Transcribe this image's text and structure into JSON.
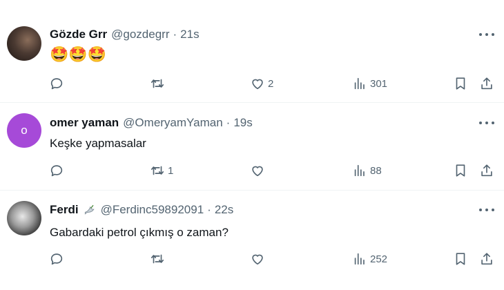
{
  "tweets": [
    {
      "name": "Gözde Grr",
      "handle": "@gozdegrr",
      "time": "21s",
      "text": "🤩🤩🤩",
      "replies": "",
      "retweets": "",
      "likes": "2",
      "views": "301"
    },
    {
      "name": "omer yaman",
      "handle": "@OmeryamYaman",
      "time": "19s",
      "avatar_letter": "o",
      "text": "Keşke yapmasalar",
      "replies": "",
      "retweets": "1",
      "likes": "",
      "views": "88"
    },
    {
      "name": "Ferdi",
      "handle": "@Ferdinc59892091",
      "time": "22s",
      "text": "Gabardaki petrol çıkmış o zaman?",
      "replies": "",
      "retweets": "",
      "likes": "",
      "views": "252"
    }
  ],
  "separator": "·",
  "colors": {
    "muted": "#536471",
    "text": "#0f1419",
    "avatar_purple": "#a64ad8"
  },
  "icons": [
    "reply-icon",
    "retweet-icon",
    "like-icon",
    "views-icon",
    "bookmark-icon",
    "share-icon",
    "more-icon",
    "dove-icon"
  ]
}
